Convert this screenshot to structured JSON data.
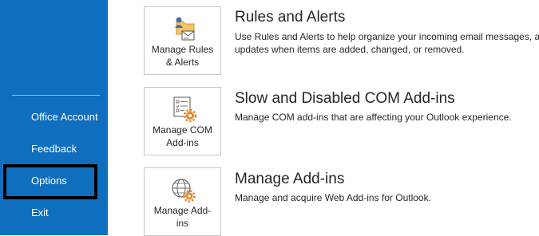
{
  "sidebar": {
    "items": [
      {
        "label": "Office Account"
      },
      {
        "label": "Feedback"
      },
      {
        "label": "Options"
      },
      {
        "label": "Exit"
      }
    ]
  },
  "sections": [
    {
      "tile_label_line1": "Manage Rules",
      "tile_label_line2": "& Alerts",
      "icon": "rules-alerts-icon",
      "title": "Rules and Alerts",
      "desc_line1": "Use Rules and Alerts to help organize your incoming email messages, and",
      "desc_line2": "updates when items are added, changed, or removed."
    },
    {
      "tile_label_line1": "Manage COM",
      "tile_label_line2": "Add-ins",
      "icon": "com-addins-icon",
      "title": "Slow and Disabled COM Add-ins",
      "desc_line1": "Manage COM add-ins that are affecting your Outlook experience."
    },
    {
      "tile_label_line1": "Manage Add-",
      "tile_label_line2": "ins",
      "icon": "web-addins-icon",
      "title": "Manage Add-ins",
      "desc_line1": "Manage and acquire Web Add-ins for Outlook."
    }
  ],
  "colors": {
    "sidebar_bg": "#106ebe",
    "accent_orange": "#e8862a"
  }
}
